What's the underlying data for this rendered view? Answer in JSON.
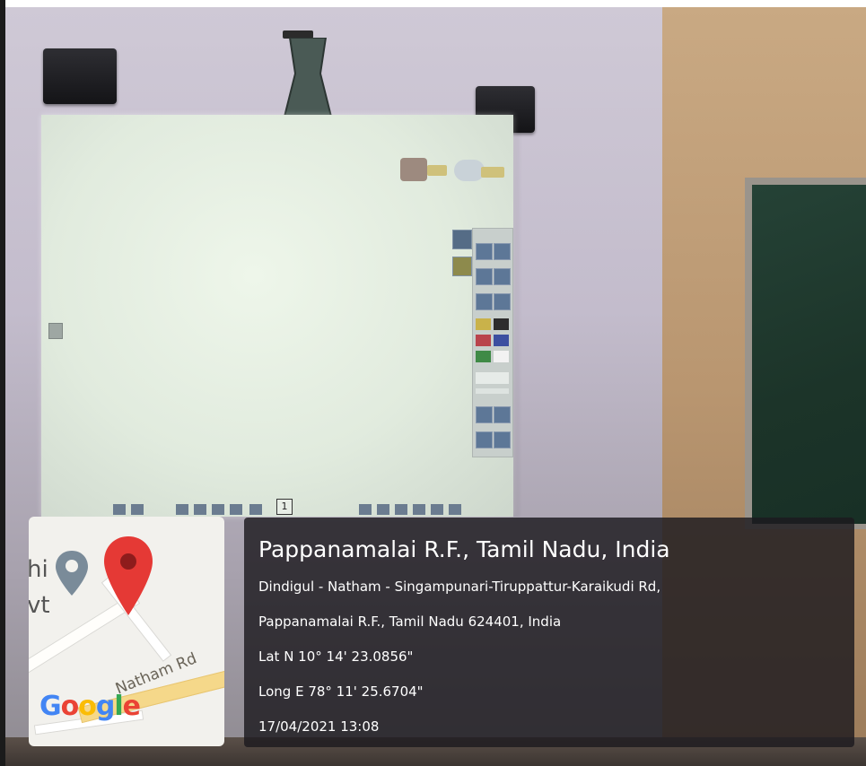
{
  "location": {
    "title": "Pappanamalai R.F., Tamil Nadu, India",
    "address_line_1": "Dindigul - Natham - Singampunari-Tiruppattur-Karaikudi Rd,",
    "address_line_2": "Pappanamalai R.F., Tamil Nadu 624401, India",
    "latitude": "Lat N 10° 14' 23.0856\"",
    "longitude": "Long E 78° 11' 25.6704\"",
    "timestamp": "17/04/2021 13:08"
  },
  "map": {
    "brand": [
      "G",
      "o",
      "o",
      "g",
      "l",
      "e"
    ],
    "brand_colors": [
      "#4285F4",
      "#EA4335",
      "#FBBC05",
      "#4285F4",
      "#34A853",
      "#EA4335"
    ],
    "road_label": "Natham Rd",
    "partial_label_1": "hi",
    "partial_label_2": "vt",
    "pin_color": "#E53935",
    "secondary_pin_color": "#7A8B99"
  },
  "projected_screen": {
    "page_number": "1"
  },
  "colors": {
    "wall": "#c3bccc",
    "chalkboard": "#1c3429",
    "panel": "#1c1a1e"
  }
}
